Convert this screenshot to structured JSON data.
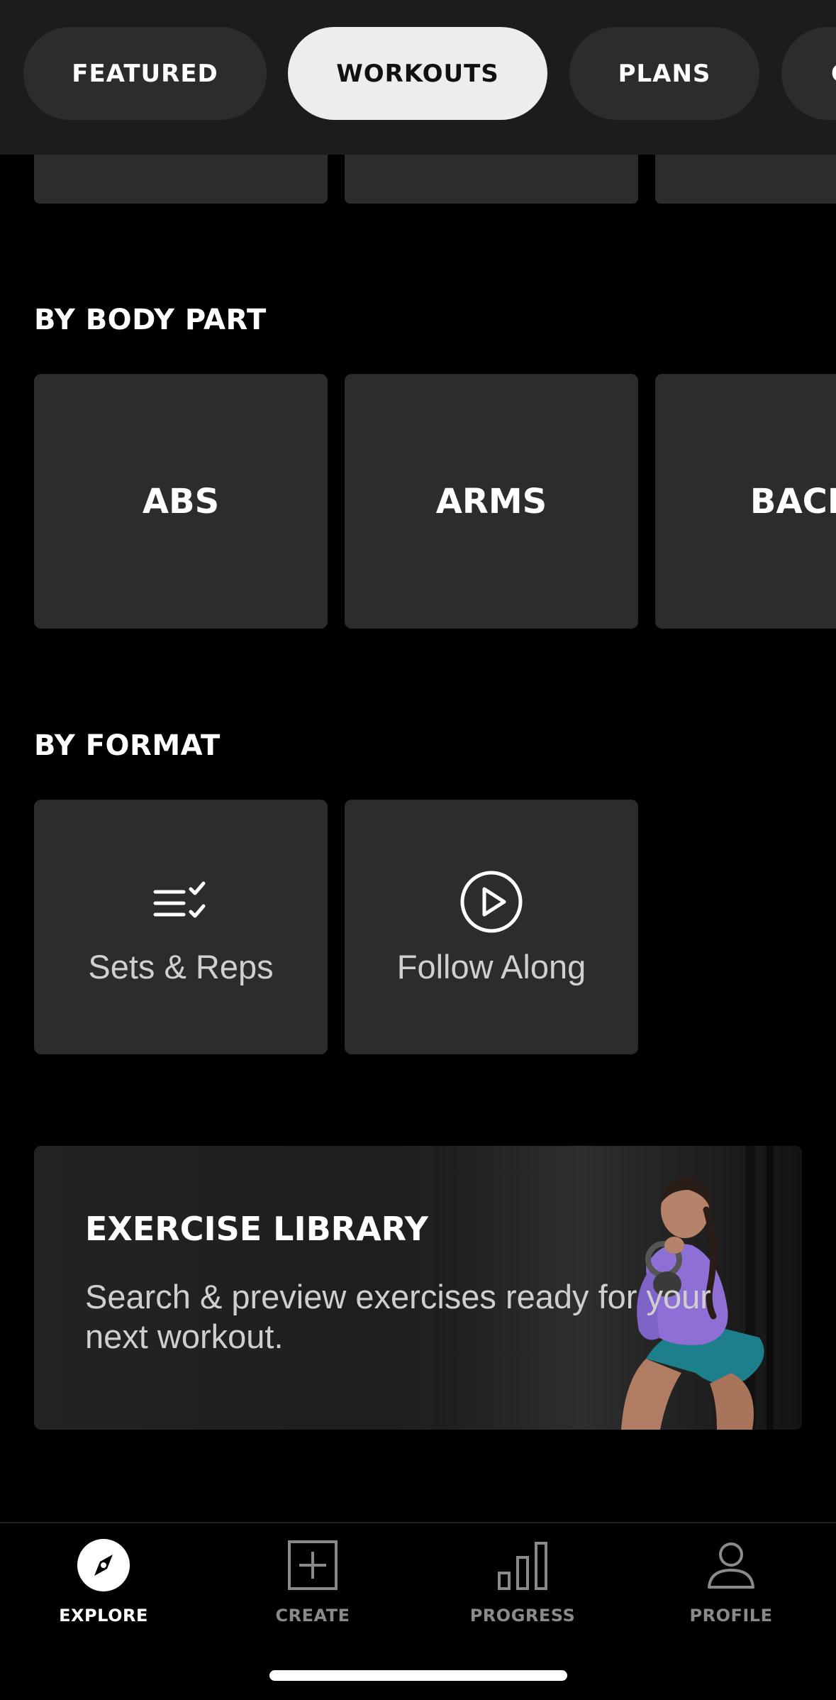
{
  "tabs": [
    {
      "label": "FEATURED",
      "active": false
    },
    {
      "label": "WORKOUTS",
      "active": true
    },
    {
      "label": "PLANS",
      "active": false
    },
    {
      "label": "C",
      "active": false
    }
  ],
  "body_part": {
    "title": "BY BODY PART",
    "items": [
      "ABS",
      "ARMS",
      "BACK"
    ]
  },
  "format": {
    "title": "BY FORMAT",
    "items": [
      {
        "label": "Sets & Reps",
        "icon": "checklist-icon"
      },
      {
        "label": "Follow Along",
        "icon": "play-circle-icon"
      }
    ]
  },
  "library": {
    "title": "EXERCISE LIBRARY",
    "description": "Search & preview exercises ready for your next workout."
  },
  "nav": [
    {
      "label": "EXPLORE",
      "icon": "compass-icon",
      "active": true
    },
    {
      "label": "CREATE",
      "icon": "plus-square-icon",
      "active": false
    },
    {
      "label": "PROGRESS",
      "icon": "bar-chart-icon",
      "active": false
    },
    {
      "label": "PROFILE",
      "icon": "person-icon",
      "active": false
    }
  ],
  "colors": {
    "background": "#000000",
    "tile": "#2c2c2e",
    "tab_active": "#ededed",
    "tab_inactive": "#2c2c2e"
  }
}
